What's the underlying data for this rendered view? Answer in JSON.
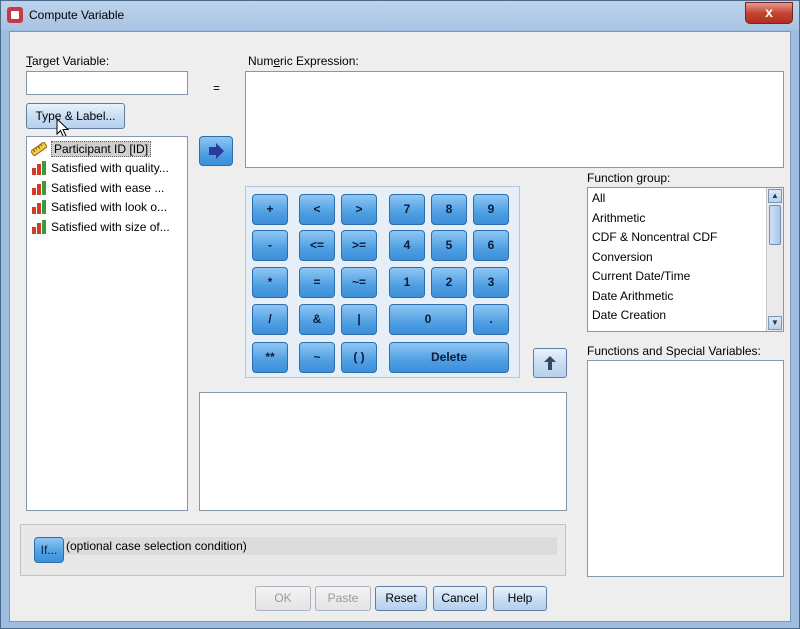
{
  "window": {
    "title": "Compute Variable",
    "close_label": "x"
  },
  "target_variable": {
    "label_prefix": "T",
    "label_rest": "arget Variable:",
    "value": ""
  },
  "equals_sign": "=",
  "numeric_expression": {
    "label_prefix": "Num",
    "label_underlined": "e",
    "label_rest": "ric Expression:",
    "value": ""
  },
  "type_label_button": {
    "label": "Type & Label..."
  },
  "variables": [
    {
      "label": "Participant ID [ID]",
      "icon": "ruler-icon",
      "selected": true
    },
    {
      "label": "Satisfied with quality...",
      "icon": "bar-chart-icon"
    },
    {
      "label": "Satisfied with ease ...",
      "icon": "bar-chart-icon"
    },
    {
      "label": "Satisfied with look o...",
      "icon": "bar-chart-icon"
    },
    {
      "label": "Satisfied with size of...",
      "icon": "bar-chart-icon"
    }
  ],
  "keypad": {
    "row1": [
      "+",
      "<",
      ">",
      "7",
      "8",
      "9"
    ],
    "row2": [
      "-",
      "<=",
      ">=",
      "4",
      "5",
      "6"
    ],
    "row3": [
      "*",
      "=",
      "~=",
      "1",
      "2",
      "3"
    ],
    "row4": [
      "/",
      "&",
      "|",
      "0",
      "."
    ],
    "row5": [
      "**",
      "~",
      "( )",
      "Delete"
    ]
  },
  "function_group": {
    "label": "Function group:",
    "items": [
      "All",
      "Arithmetic",
      "CDF & Noncentral CDF",
      "Conversion",
      "Current Date/Time",
      "Date Arithmetic",
      "Date Creation"
    ]
  },
  "functions_special": {
    "label": "Functions and Special Variables:"
  },
  "if_button": {
    "label": "If..."
  },
  "if_condition_text": "(optional case selection condition)",
  "dialog_buttons": {
    "ok": "OK",
    "paste": "Paste",
    "reset": "Reset",
    "cancel": "Cancel",
    "help": "Help"
  },
  "colors": {
    "keypad_blue": "#4f9fe2",
    "title_bar": "#bcd3ec",
    "close_red": "#c54533"
  }
}
